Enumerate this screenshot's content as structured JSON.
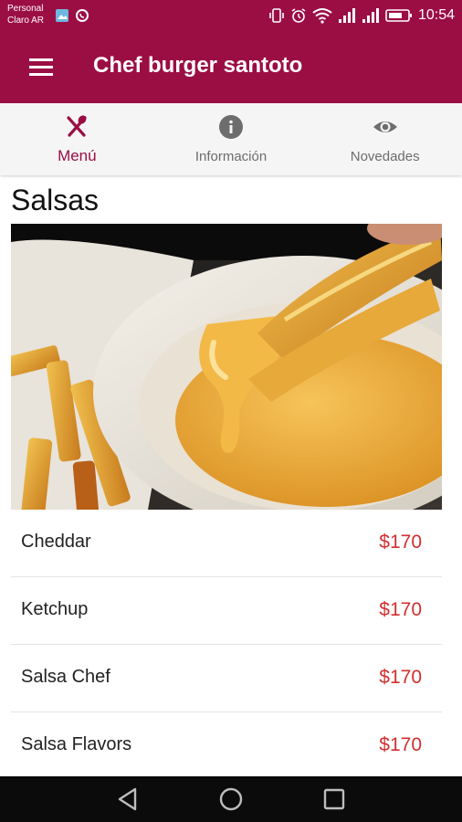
{
  "status_bar": {
    "carrier_line1": "Personal",
    "carrier_line2": "Claro AR",
    "time": "10:54",
    "icons": [
      "image-icon",
      "whatsapp-icon",
      "vibrate-icon",
      "alarm-icon",
      "wifi-icon",
      "signal-icon",
      "signal-icon",
      "battery-icon"
    ]
  },
  "app_bar": {
    "title": "Chef burger santoto",
    "menu_icon": "hamburger-menu-icon"
  },
  "tabs": [
    {
      "label": "Menú",
      "icon": "utensils-icon",
      "active": true
    },
    {
      "label": "Información",
      "icon": "info-icon",
      "active": false
    },
    {
      "label": "Novedades",
      "icon": "eye-icon",
      "active": false
    }
  ],
  "section": {
    "title": "Salsas",
    "image": "cheddar-sauce-fries-photo"
  },
  "items": [
    {
      "name": "Cheddar",
      "price": "$170"
    },
    {
      "name": "Ketchup",
      "price": "$170"
    },
    {
      "name": "Salsa Chef",
      "price": "$170"
    },
    {
      "name": "Salsa Flavors",
      "price": "$170"
    }
  ],
  "nav_bar": {
    "buttons": [
      "back-icon",
      "home-icon",
      "recents-icon"
    ]
  },
  "colors": {
    "primary": "#9b0e44",
    "price": "#d32f2f",
    "tab_inactive": "#6d6d6d"
  }
}
